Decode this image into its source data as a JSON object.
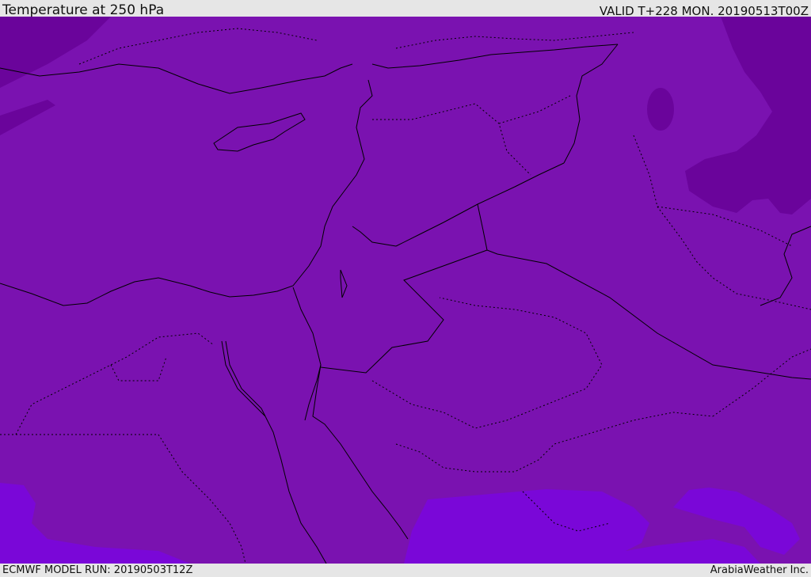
{
  "header": {
    "title": "Temperature at 250 hPa",
    "valid": "VALID T+228 MON. 20190513T00Z"
  },
  "footer": {
    "model_run": "ECMWF MODEL RUN: 20190503T12Z",
    "brand": "ArabiaWeather Inc."
  },
  "map": {
    "colors": {
      "base": "#7a12b0",
      "cold": "#6a049b",
      "warm": "#7a07d8",
      "border": "#000000"
    }
  }
}
